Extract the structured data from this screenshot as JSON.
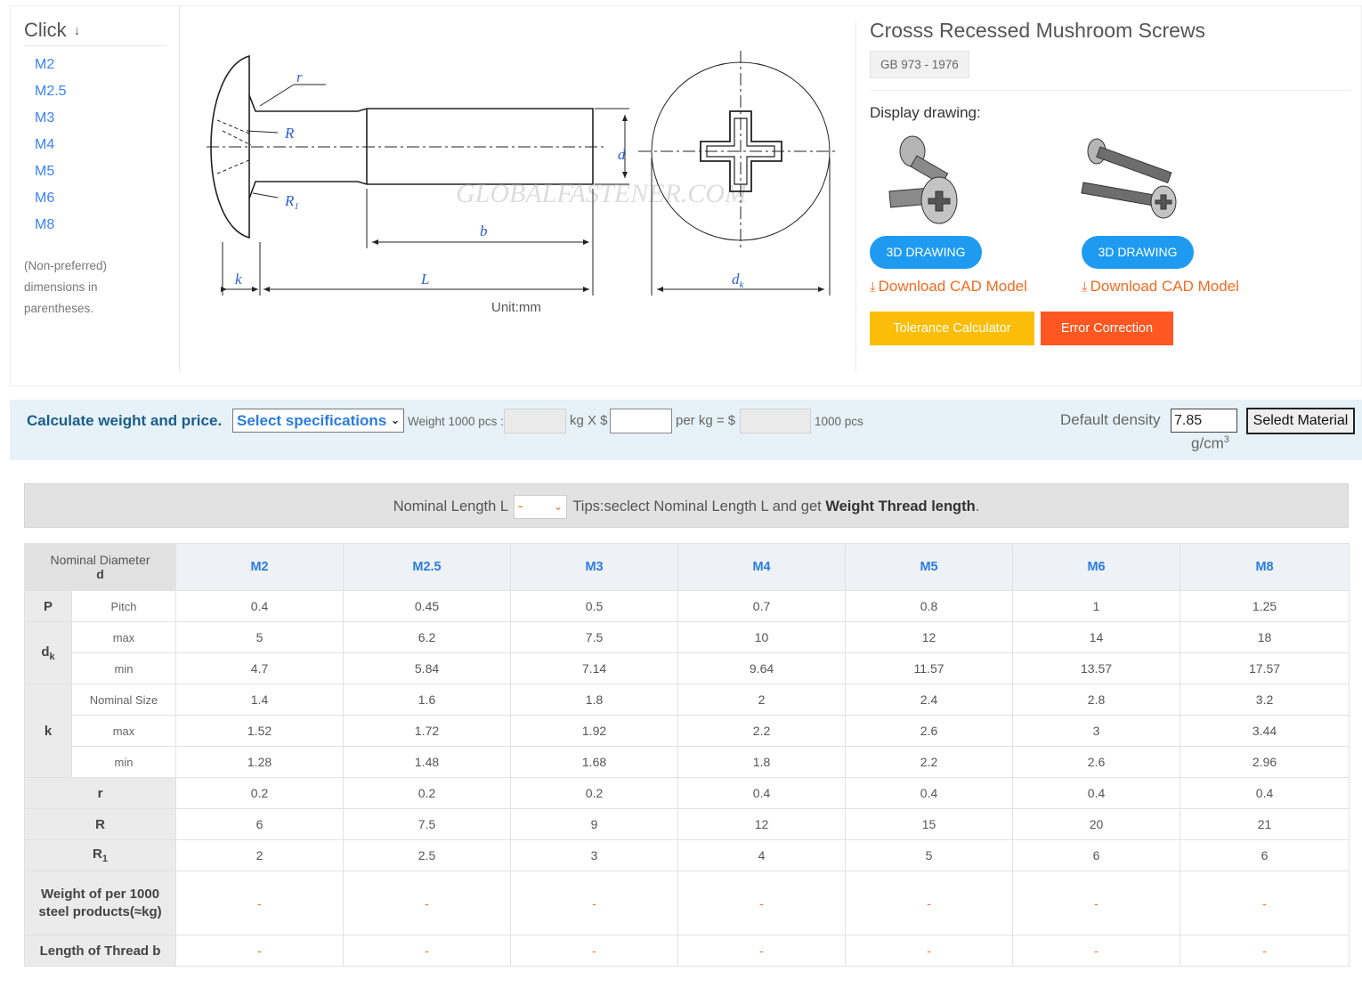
{
  "sidebar": {
    "title": "Click",
    "title_icon": "arrow-down-icon",
    "sizes": [
      "M2",
      "M2.5",
      "M3",
      "M4",
      "M5",
      "M6",
      "M8"
    ],
    "note": "(Non-preferred) dimensions in parentheses."
  },
  "drawing": {
    "labels": {
      "r": "r",
      "R": "R",
      "R1": "R",
      "R1_sub": "1",
      "d": "d",
      "b": "b",
      "k": "k",
      "L": "L",
      "dk": "d",
      "dk_sub": "k"
    },
    "watermark": "GLOBALFASTENER.COM",
    "unit": "Unit:mm"
  },
  "product": {
    "title": "Crosss Recessed Mushroom Screws",
    "standard": "GB 973 - 1976",
    "display_label": "Display drawing:",
    "btn_3d": "3D DRAWING",
    "download_cad": "Download CAD Model",
    "download_icon": "download-icon",
    "tolerance_btn": "Tolerance Calculator",
    "error_btn": "Error Correction"
  },
  "calc": {
    "title": "Calculate weight and price.",
    "select_spec": "Select specifications",
    "weight_label": "Weight 1000 pcs :",
    "kg_label": "kg X $",
    "per_kg_label": "per kg = $",
    "pcs_label": "1000 pcs",
    "density_label": "Default density",
    "density_value": "7.85",
    "density_unit": "g/cm",
    "density_unit_sup": "3",
    "material_btn": "Seledt Material"
  },
  "length_bar": {
    "prefix": "Nominal Length L",
    "selected": "-",
    "tips": "Tips:seclect Nominal Length L and get ",
    "tips_bold": "Weight Thread length",
    "tips_end": "."
  },
  "table": {
    "header_label": "Nominal Diameter",
    "header_sub": "d",
    "columns": [
      "M2",
      "M2.5",
      "M3",
      "M4",
      "M5",
      "M6",
      "M8"
    ],
    "rows": {
      "P": {
        "label": "P",
        "sub": "Pitch",
        "values": [
          "0.4",
          "0.45",
          "0.5",
          "0.7",
          "0.8",
          "1",
          "1.25"
        ]
      },
      "dk": {
        "label": "d",
        "label_sub": "k",
        "max_label": "max",
        "min_label": "min",
        "max": [
          "5",
          "6.2",
          "7.5",
          "10",
          "12",
          "14",
          "18"
        ],
        "min": [
          "4.7",
          "5.84",
          "7.14",
          "9.64",
          "11.57",
          "13.57",
          "17.57"
        ]
      },
      "k": {
        "label": "k",
        "nom_label": "Nominal Size",
        "max_label": "max",
        "min_label": "min",
        "nom": [
          "1.4",
          "1.6",
          "1.8",
          "2",
          "2.4",
          "2.8",
          "3.2"
        ],
        "max": [
          "1.52",
          "1.72",
          "1.92",
          "2.2",
          "2.6",
          "3",
          "3.44"
        ],
        "min": [
          "1.28",
          "1.48",
          "1.68",
          "1.8",
          "2.2",
          "2.6",
          "2.96"
        ]
      },
      "r": {
        "label": "r",
        "values": [
          "0.2",
          "0.2",
          "0.2",
          "0.4",
          "0.4",
          "0.4",
          "0.4"
        ]
      },
      "R": {
        "label": "R",
        "values": [
          "6",
          "7.5",
          "9",
          "12",
          "15",
          "20",
          "21"
        ]
      },
      "R1": {
        "label": "R",
        "label_sub": "1",
        "values": [
          "2",
          "2.5",
          "3",
          "4",
          "5",
          "6",
          "6"
        ]
      },
      "weight": {
        "label": "Weight of per 1000 steel products(≈kg)",
        "values": [
          "-",
          "-",
          "-",
          "-",
          "-",
          "-",
          "-"
        ]
      },
      "thread": {
        "label": "Length of Thread b",
        "values": [
          "-",
          "-",
          "-",
          "-",
          "-",
          "-",
          "-"
        ]
      }
    }
  }
}
